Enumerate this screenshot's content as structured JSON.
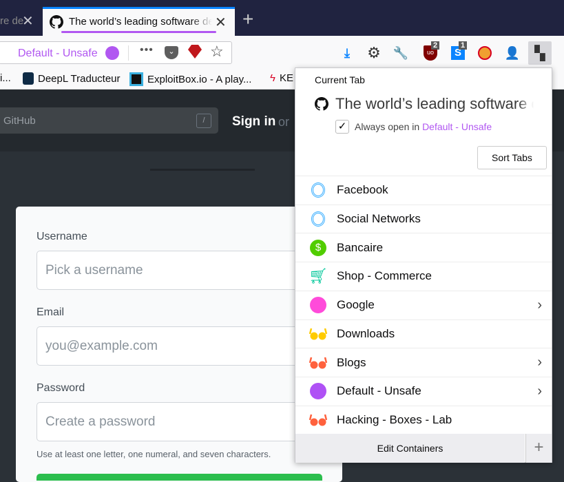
{
  "browser": {
    "inactive_tab_title": "re de",
    "active_tab_title": "The world’s leading software development platform",
    "container_label": "Default - Unsafe",
    "container_color": "#b157f1",
    "badges": {
      "ublock": "2",
      "skype": "1"
    },
    "bookmarks": [
      "i...",
      "DeepL Traducteur",
      "ExploitBox.io - A play...",
      "KE"
    ]
  },
  "github": {
    "search_placeholder": "GitHub",
    "search_key": "/",
    "sign_in": "Sign in",
    "or": "or",
    "form": {
      "username_label": "Username",
      "username_placeholder": "Pick a username",
      "email_label": "Email",
      "email_placeholder": "you@example.com",
      "password_label": "Password",
      "password_placeholder": "Create a password",
      "password_hint": "Use at least one letter, one numeral, and seven characters."
    }
  },
  "popup": {
    "heading": "Current Tab",
    "tab_title": "The world’s leading software development platform",
    "always_open_prefix": "Always open in",
    "always_open_container": "Default - Unsafe",
    "always_open_checked": true,
    "sort_tabs": "Sort Tabs",
    "containers": [
      {
        "name": "Facebook",
        "icon": "fingerprint",
        "color": "#37adff",
        "submenu": false
      },
      {
        "name": "Social Networks",
        "icon": "fingerprint",
        "color": "#37adff",
        "submenu": false
      },
      {
        "name": "Bancaire",
        "icon": "dollar",
        "color": "#51cd00",
        "submenu": false
      },
      {
        "name": "Shop - Commerce",
        "icon": "cart",
        "color": "#00c79a",
        "submenu": false
      },
      {
        "name": "Google",
        "icon": "circle",
        "color": "#ff4bda",
        "submenu": true
      },
      {
        "name": "Downloads",
        "icon": "glasses",
        "color": "#ffcb00",
        "submenu": false
      },
      {
        "name": "Blogs",
        "icon": "glasses",
        "color": "#ff613d",
        "submenu": true
      },
      {
        "name": "Default - Unsafe",
        "icon": "circle",
        "color": "#af51f5",
        "submenu": true
      },
      {
        "name": "Hacking - Boxes - Lab",
        "icon": "glasses",
        "color": "#ff613d",
        "submenu": false
      }
    ],
    "edit_containers": "Edit Containers",
    "add": "+"
  }
}
